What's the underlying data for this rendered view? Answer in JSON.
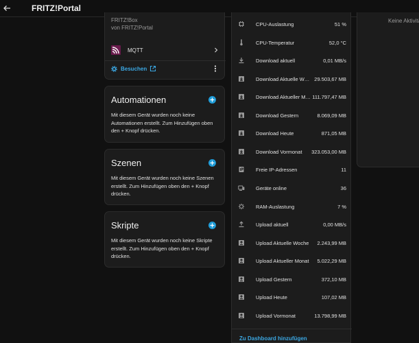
{
  "header": {
    "title": "FRITZ!Portal"
  },
  "device_card": {
    "model": "FRITZ!Box",
    "manufacturer": "von FRITZ!Portal",
    "integration_label": "MQTT",
    "search_label": "Besuchen"
  },
  "sections": [
    {
      "title": "Automationen",
      "body": "Mit diesem Gerät wurden noch keine Automationen erstellt. Zum Hinzufügen oben den + Knopf drücken."
    },
    {
      "title": "Szenen",
      "body": "Mit diesem Gerät wurden noch keine Szenen erstellt. Zum Hinzufügen oben den + Knopf drücken."
    },
    {
      "title": "Skripte",
      "body": "Mit diesem Gerät wurden noch keine Skripte erstellt. Zum Hinzufügen oben den + Knopf drücken."
    }
  ],
  "sensors": [
    {
      "label": "CPU-Auslastung",
      "value": "51 %",
      "icon": "cpu-icon"
    },
    {
      "label": "CPU-Temperatur",
      "value": "52,0 °C",
      "icon": "thermometer-icon"
    },
    {
      "label": "Download aktuell",
      "value": "0,01 MB/s",
      "icon": "download-icon"
    },
    {
      "label": "Download Aktuelle Woche",
      "value": "29.503,67 MB",
      "icon": "download-box-icon"
    },
    {
      "label": "Download Aktueller Monat",
      "value": "111.797,47 MB",
      "icon": "download-box-icon"
    },
    {
      "label": "Download Gestern",
      "value": "8.069,09 MB",
      "icon": "download-box-icon"
    },
    {
      "label": "Download Heute",
      "value": "871,05 MB",
      "icon": "download-box-icon"
    },
    {
      "label": "Download Vormonat",
      "value": "323.053,00 MB",
      "icon": "download-box-icon"
    },
    {
      "label": "Freie IP-Adressen",
      "value": "11",
      "icon": "ip-icon"
    },
    {
      "label": "Geräte online",
      "value": "36",
      "icon": "devices-icon"
    },
    {
      "label": "RAM-Auslastung",
      "value": "7 %",
      "icon": "ram-icon"
    },
    {
      "label": "Upload aktuell",
      "value": "0,00 MB/s",
      "icon": "upload-icon"
    },
    {
      "label": "Upload Aktuelle Woche",
      "value": "2.243,99 MB",
      "icon": "upload-box-icon"
    },
    {
      "label": "Upload Aktueller Monat",
      "value": "5.022,29 MB",
      "icon": "upload-box-icon"
    },
    {
      "label": "Upload Gestern",
      "value": "372,10 MB",
      "icon": "upload-box-icon"
    },
    {
      "label": "Upload Heute",
      "value": "107,02 MB",
      "icon": "upload-box-icon"
    },
    {
      "label": "Upload Vormonat",
      "value": "13.798,99 MB",
      "icon": "upload-box-icon"
    }
  ],
  "panel": {
    "add_to_dashboard": "Zu Dashboard hinzufügen"
  },
  "right_card": {
    "text": "Keine Aktivitäten"
  },
  "colors": {
    "accent": "#3ba7e2",
    "plus": "#1e9bd7",
    "mqtt": "#c2185b",
    "icon": "#9a9a9a"
  }
}
